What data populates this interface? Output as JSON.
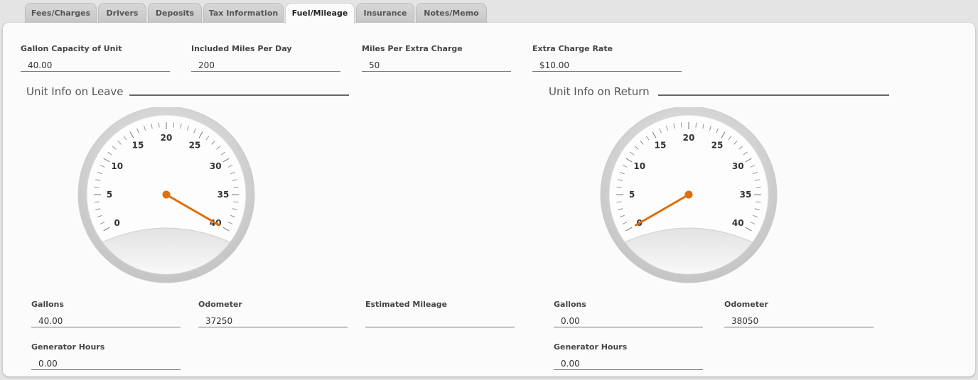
{
  "tabs": [
    {
      "label": "Fees/Charges",
      "active": false
    },
    {
      "label": "Drivers",
      "active": false
    },
    {
      "label": "Deposits",
      "active": false
    },
    {
      "label": "Tax Information",
      "active": false
    },
    {
      "label": "Fuel/Mileage",
      "active": true
    },
    {
      "label": "Insurance",
      "active": false
    },
    {
      "label": "Notes/Memo",
      "active": false
    }
  ],
  "fields": {
    "gallon_capacity": {
      "label": "Gallon Capacity of Unit",
      "value": "40.00"
    },
    "included_miles": {
      "label": "Included Miles Per Day",
      "value": "200"
    },
    "miles_per_extra": {
      "label": "Miles Per Extra Charge",
      "value": "50"
    },
    "extra_charge_rate": {
      "label": "Extra Charge Rate",
      "value": "$10.00"
    }
  },
  "leave": {
    "title": "Unit Info on Leave",
    "gauge": {
      "value": 40,
      "min": 0,
      "max": 40,
      "ticks": [
        "0",
        "5",
        "10",
        "15",
        "20",
        "25",
        "30",
        "35",
        "40"
      ]
    },
    "gallons": {
      "label": "Gallons",
      "value": "40.00"
    },
    "odometer": {
      "label": "Odometer",
      "value": "37250"
    },
    "generator_hours": {
      "label": "Generator Hours",
      "value": "0.00"
    }
  },
  "estimated_mileage": {
    "label": "Estimated Mileage",
    "value": ""
  },
  "return": {
    "title": "Unit Info on Return",
    "gauge": {
      "value": 0,
      "min": 0,
      "max": 40,
      "ticks": [
        "0",
        "5",
        "10",
        "15",
        "20",
        "25",
        "30",
        "35",
        "40"
      ]
    },
    "gallons": {
      "label": "Gallons",
      "value": "0.00"
    },
    "odometer": {
      "label": "Odometer",
      "value": "38050"
    },
    "generator_hours": {
      "label": "Generator Hours",
      "value": "0.00"
    }
  },
  "colors": {
    "needle": "#e06c0a",
    "accent_tab": "#fbfbfb"
  }
}
